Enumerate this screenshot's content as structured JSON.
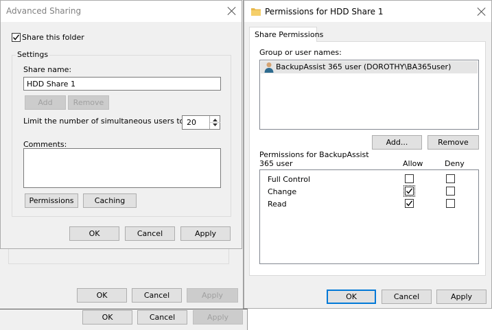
{
  "background_dialog": {
    "ok_label": "OK",
    "cancel_label": "Cancel",
    "apply_label": "Apply"
  },
  "back_dialog": {
    "ok_label": "OK",
    "cancel_label": "Cancel",
    "apply_label": "Apply"
  },
  "advanced_sharing": {
    "title": "Advanced Sharing",
    "share_checkbox_label": "Share this folder",
    "share_checked": true,
    "settings_legend": "Settings",
    "share_name_label": "Share name:",
    "share_name_value": "HDD Share 1",
    "add_label": "Add",
    "remove_label": "Remove",
    "limit_label": "Limit the number of simultaneous users to:",
    "limit_value": "20",
    "comments_label": "Comments:",
    "comments_value": "",
    "permissions_label": "Permissions",
    "caching_label": "Caching",
    "ok_label": "OK",
    "cancel_label": "Cancel",
    "apply_label": "Apply"
  },
  "permissions_dialog": {
    "title": "Permissions for HDD Share 1",
    "tab_label": "Share Permissions",
    "group_label": "Group or user names:",
    "users": [
      {
        "name": "BackupAssist 365 user (DOROTHY\\BA365user)",
        "icon": "user-icon"
      }
    ],
    "add_label": "Add...",
    "remove_label": "Remove",
    "perm_for_label": "Permissions for BackupAssist 365 user",
    "allow_header": "Allow",
    "deny_header": "Deny",
    "permissions": [
      {
        "name": "Full Control",
        "allow": false,
        "deny": false
      },
      {
        "name": "Change",
        "allow": true,
        "deny": false
      },
      {
        "name": "Read",
        "allow": true,
        "deny": false
      }
    ],
    "ok_label": "OK",
    "cancel_label": "Cancel",
    "apply_label": "Apply"
  }
}
